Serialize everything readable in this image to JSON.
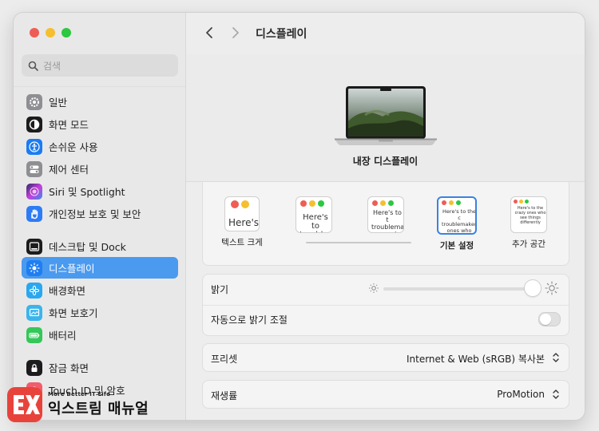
{
  "window": {
    "title": "디스플레이"
  },
  "traffic_lights": {
    "close": "#ee5d55",
    "minimize": "#f5bf2f",
    "zoom": "#2cc840"
  },
  "search": {
    "placeholder": "검색",
    "icon": "search-icon"
  },
  "sidebar": {
    "items": [
      {
        "label": "일반",
        "icon": "gear-icon",
        "color": "#8e8e93"
      },
      {
        "label": "화면 모드",
        "icon": "appearance-icon",
        "color": "#1c1c1e"
      },
      {
        "label": "손쉬운 사용",
        "icon": "accessibility-icon",
        "color": "#1a7cf2"
      },
      {
        "label": "제어 센터",
        "icon": "control-center-icon",
        "color": "#8e8e93"
      },
      {
        "label": "Siri 및 Spotlight",
        "icon": "siri-icon",
        "color": "#7a3cf0"
      },
      {
        "label": "개인정보 보호 및 보안",
        "icon": "hand-icon",
        "color": "#2d7cf6"
      },
      {
        "label": "데스크탑 및 Dock",
        "icon": "dock-icon",
        "color": "#1c1c1e"
      },
      {
        "label": "디스플레이",
        "icon": "display-brightness-icon",
        "color": "#1e7ef2",
        "active": true
      },
      {
        "label": "배경화면",
        "icon": "wallpaper-icon",
        "color": "#29a8f0"
      },
      {
        "label": "화면 보호기",
        "icon": "screensaver-icon",
        "color": "#3bb4ec"
      },
      {
        "label": "배터리",
        "icon": "battery-icon",
        "color": "#34c759"
      },
      {
        "label": "잠금 화면",
        "icon": "lock-icon",
        "color": "#1c1c1e"
      },
      {
        "label": "Touch ID 및 암호",
        "icon": "fingerprint-icon",
        "color": "#f25c6b"
      }
    ]
  },
  "nav": {
    "back": "back-chevron-icon",
    "forward": "forward-chevron-icon"
  },
  "display": {
    "name": "내장 디스플레이"
  },
  "resolution": {
    "options": [
      {
        "label": "텍스트 크게",
        "thumb_text": "Here's"
      },
      {
        "label": "",
        "thumb_text": "Here's to troublem"
      },
      {
        "label": "",
        "thumb_text": "Here's to t troublema ones who"
      },
      {
        "label": "기본 설정",
        "thumb_text": "Here's to the c troublemakers. ones who see t",
        "selected": true
      },
      {
        "label": "추가 공간",
        "thumb_text": "Here's to the crazy ones who see things differently"
      }
    ]
  },
  "brightness": {
    "label": "밝기",
    "level": 1.0
  },
  "auto_brightness": {
    "label": "자동으로 밝기 조절",
    "enabled": false
  },
  "preset": {
    "label": "프리셋",
    "value": "Internet & Web (sRGB) 복사본"
  },
  "refresh_rate": {
    "label": "재생률",
    "value": "ProMotion"
  },
  "watermark": {
    "tagline": "More Better IT Life",
    "name": "익스트림 매뉴얼"
  }
}
